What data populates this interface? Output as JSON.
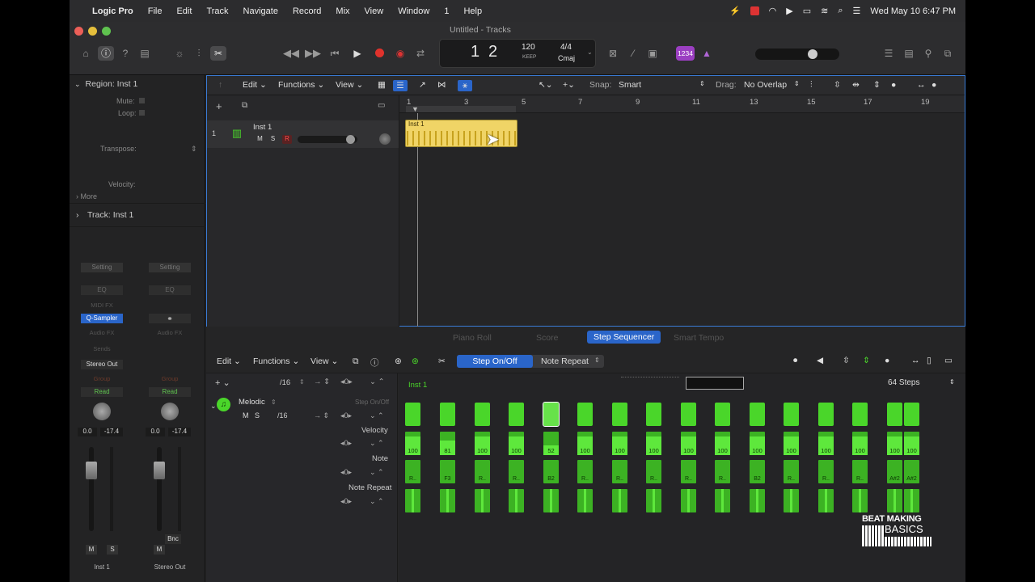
{
  "menubar": {
    "app": "Logic Pro",
    "items": [
      "File",
      "Edit",
      "Track",
      "Navigate",
      "Record",
      "Mix",
      "View",
      "Window",
      "1",
      "Help"
    ],
    "clock": "Wed May 10  6:47 PM"
  },
  "window": {
    "title": "Untitled - Tracks"
  },
  "lcd": {
    "bar": "1",
    "beat": "2",
    "tempo": "120",
    "tempo_mode": "KEEP",
    "signature": "4/4",
    "key": "Cmaj"
  },
  "counter_badge": "1234",
  "inspector": {
    "region_label": "Region: Inst 1",
    "mute": "Mute:",
    "loop": "Loop:",
    "transpose": "Transpose:",
    "velocity": "Velocity:",
    "more": "More",
    "track_label": "Track: Inst 1"
  },
  "mixer": {
    "left": {
      "setting": "Setting",
      "eq": "EQ",
      "midi_fx": "MIDI FX",
      "instrument": "Q-Sampler",
      "audio_fx": "Audio FX",
      "sends": "Sends",
      "output": "Stereo Out",
      "group": "Group",
      "automation": "Read",
      "vol": "0.0",
      "peak": "-17.4",
      "m": "M",
      "s": "S",
      "name": "Inst 1"
    },
    "right": {
      "setting": "Setting",
      "eq": "EQ",
      "audio_fx": "Audio FX",
      "group": "Group",
      "automation": "Read",
      "vol": "0.0",
      "peak": "-17.4",
      "m": "M",
      "bnc": "Bnc",
      "name": "Stereo Out"
    }
  },
  "tracks_toolbar": {
    "edit": "Edit",
    "functions": "Functions",
    "view": "View",
    "snap_label": "Snap:",
    "snap_value": "Smart",
    "drag_label": "Drag:",
    "drag_value": "No Overlap"
  },
  "ruler": [
    "1",
    "3",
    "5",
    "7",
    "9",
    "11",
    "13",
    "15",
    "17",
    "19"
  ],
  "track": {
    "number": "1",
    "name": "Inst 1",
    "m": "M",
    "s": "S",
    "r": "R"
  },
  "region": {
    "name": "Inst 1"
  },
  "editor_tabs": [
    "Piano Roll",
    "Score",
    "Step Sequencer",
    "Smart Tempo"
  ],
  "active_tab": "Step Sequencer",
  "step_sequencer": {
    "edit": "Edit",
    "functions": "Functions",
    "view": "View",
    "mode_step": "Step On/Off",
    "mode_repeat": "Note Repeat",
    "rate": "/16",
    "pattern_name": "Inst 1",
    "steps": "64 Steps",
    "row_name": "Melodic",
    "row_m": "M",
    "row_s": "S",
    "row_rate": "/16",
    "row_mode": "Step On/Off",
    "sub_velocity": "Velocity",
    "sub_note": "Note",
    "sub_repeat": "Note Repeat",
    "velocities": [
      "100",
      "81",
      "100",
      "100",
      "52",
      "100",
      "100",
      "100",
      "100",
      "100",
      "100",
      "100",
      "100",
      "100",
      "100",
      "100"
    ],
    "notes": [
      "R..",
      "F3",
      "R..",
      "R..",
      "B2",
      "R..",
      "R..",
      "R..",
      "R..",
      "R..",
      "B2",
      "R..",
      "R..",
      "R..",
      "A#2",
      "A#2"
    ]
  },
  "watermark": {
    "line1": "BEAT MAKING",
    "line2": "BASICS"
  }
}
